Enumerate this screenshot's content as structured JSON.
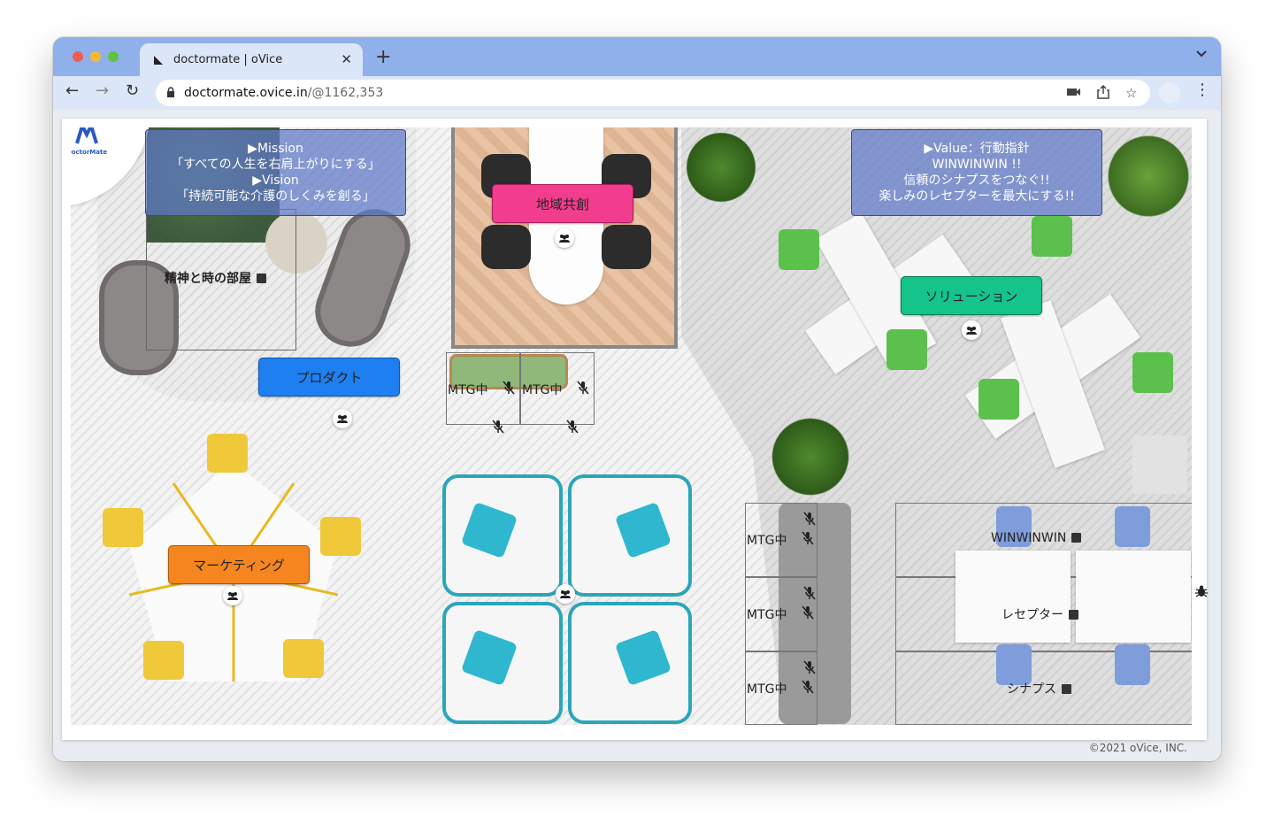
{
  "browser": {
    "tab": {
      "title": "doctormate | oVice",
      "close": "✕"
    },
    "new_tab": "+",
    "tab_menu": "⌄",
    "url": {
      "host": "doctormate.ovice.in",
      "path": "/@1162,353"
    },
    "nav": {
      "back": "←",
      "forward": "→",
      "reload": "↻"
    },
    "icons": {
      "camera": "■",
      "share": "⇪",
      "star": "☆",
      "more": "⋮",
      "lock": "🔒"
    }
  },
  "logo": {
    "text": "DoctorMate"
  },
  "mission_box": {
    "line1": "▶Mission",
    "line2": "「すべての人生を右肩上がりにする」",
    "line3": "▶Vision",
    "line4": "「持続可能な介護のしくみを創る」"
  },
  "value_box": {
    "line1": "▶Value：行動指針",
    "line2": "WINWINWIN !!",
    "line3": "信頼のシナプスをつなぐ!!",
    "line4": "楽しみのレセプターを最大にする!!"
  },
  "rooms": {
    "seishin": "精神と時の部屋",
    "winwinwin": "WINWINWIN",
    "receptor": "レセプター",
    "synapse": "シナプス"
  },
  "labels": {
    "product": "プロダクト",
    "chiiki": "地域共創",
    "solution": "ソリューション",
    "marketing": "マーケティング"
  },
  "mtg": {
    "text": "MTG中"
  },
  "icons": {
    "people": "👥",
    "mute": "🎙̸",
    "bug": "🐞"
  },
  "colors": {
    "product": "#1e7ff0",
    "chiiki": "#f23d8f",
    "solution": "#14c48a",
    "marketing": "#f5861f",
    "yellow_chair": "#f0c93a",
    "green_chair": "#5cc04d",
    "teal_chair": "#2eb7cf",
    "blue_chair": "#7f9ddb"
  },
  "footer": {
    "copyright": "©2021 oVice, INC."
  }
}
